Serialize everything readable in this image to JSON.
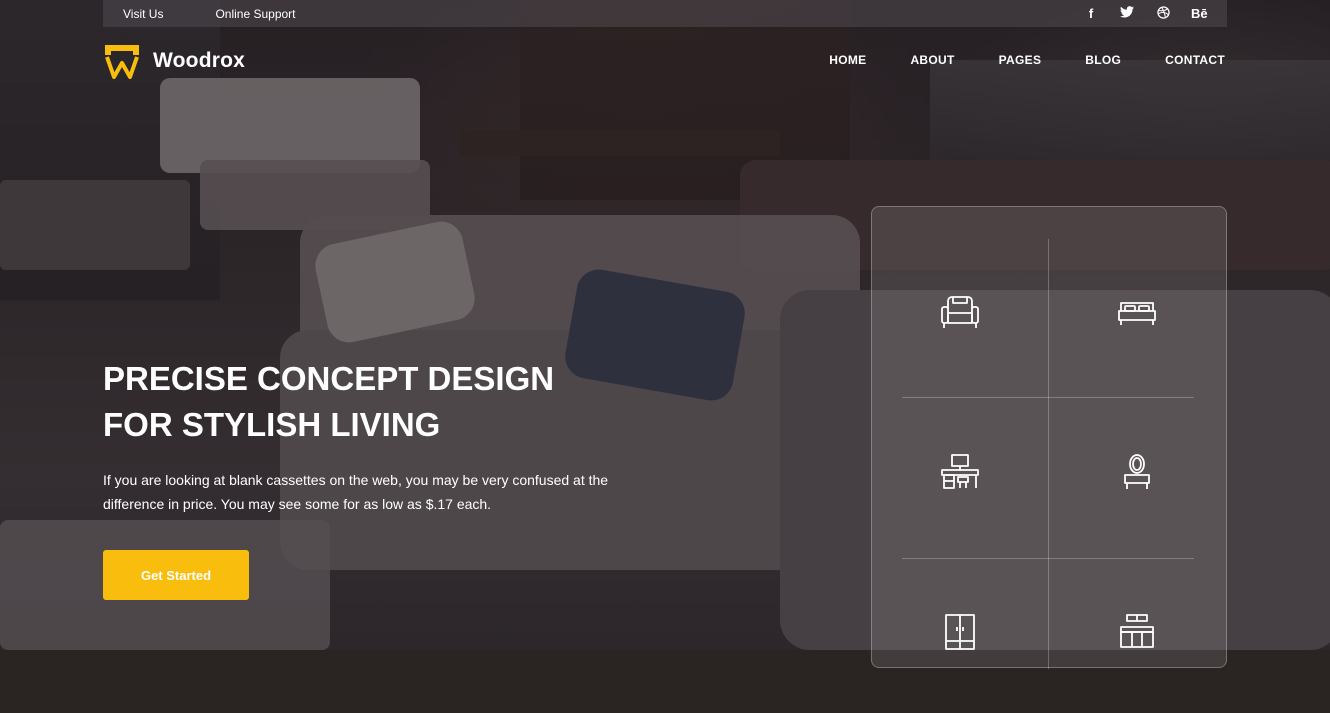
{
  "topbar": {
    "links": [
      "Visit Us",
      "Online Support"
    ],
    "social": [
      {
        "icon": "facebook-icon",
        "glyph": "f"
      },
      {
        "icon": "twitter-icon",
        "glyph": "🐦"
      },
      {
        "icon": "dribbble-icon",
        "glyph": "◎"
      },
      {
        "icon": "behance-icon",
        "glyph": "Bē"
      }
    ]
  },
  "brand": {
    "name": "Woodrox",
    "accent": "#f9bd0d"
  },
  "nav": {
    "items": [
      "HOME",
      "ABOUT",
      "PAGES",
      "BLOG",
      "CONTACT"
    ]
  },
  "hero": {
    "title_line1": "PRECISE CONCEPT DESIGN",
    "title_line2": "FOR STYLISH LIVING",
    "description": "If you are looking at blank cassettes on the web, you may be very confused at the difference in price. You may see some for as low as $.17 each.",
    "cta_label": "Get Started"
  },
  "categories": [
    {
      "icon": "armchair-icon"
    },
    {
      "icon": "bed-icon"
    },
    {
      "icon": "desk-icon"
    },
    {
      "icon": "dressing-table-icon"
    },
    {
      "icon": "wardrobe-icon"
    },
    {
      "icon": "kitchen-cabinet-icon"
    }
  ]
}
